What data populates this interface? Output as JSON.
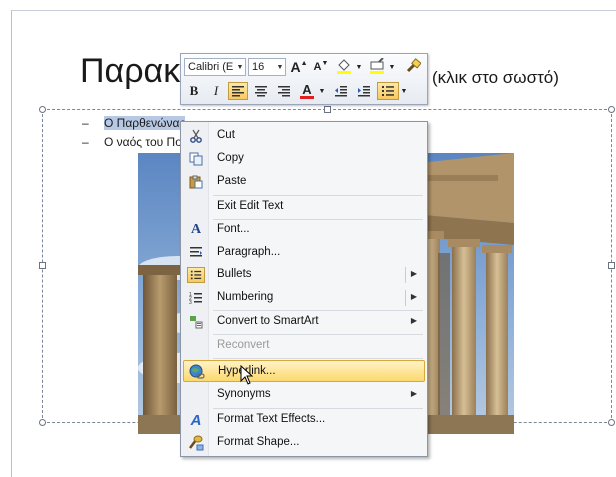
{
  "slide": {
    "title_left": "Παρακ",
    "title_right": "(κλικ στο σωστό)",
    "bullets": [
      {
        "text": "Ο Παρθενώνας",
        "selected": true
      },
      {
        "text": "Ο ναός του Πο",
        "selected": false
      }
    ]
  },
  "mini_toolbar": {
    "font_name": "Calibri (E",
    "font_size": "16",
    "bold_label": "B",
    "italic_label": "I",
    "grow_font_label": "A",
    "shrink_font_label": "A",
    "font_color_label": "A"
  },
  "context_menu": {
    "items": [
      {
        "label": "Cut",
        "icon": "scissors-icon"
      },
      {
        "label": "Copy",
        "icon": "copy-icon"
      },
      {
        "label": "Paste",
        "icon": "paste-icon"
      },
      {
        "label": "Exit Edit Text",
        "icon": ""
      },
      {
        "label": "Font...",
        "icon": "font-icon"
      },
      {
        "label": "Paragraph...",
        "icon": "paragraph-icon"
      },
      {
        "label": "Bullets",
        "icon": "bullets-icon",
        "submenu": true
      },
      {
        "label": "Numbering",
        "icon": "numbering-icon",
        "submenu": true
      },
      {
        "label": "Convert to SmartArt",
        "icon": "smartart-icon",
        "submenu": true
      },
      {
        "label": "Reconvert",
        "icon": "",
        "disabled": true
      },
      {
        "label": "Hyperlink...",
        "icon": "hyperlink-icon",
        "highlighted": true
      },
      {
        "label": "Synonyms",
        "icon": "",
        "submenu": true
      },
      {
        "label": "Format Text Effects...",
        "icon": "text-effects-icon"
      },
      {
        "label": "Format Shape...",
        "icon": "format-shape-icon"
      }
    ]
  },
  "colors": {
    "highlight": "#fcd96e",
    "selection": "#b6c8e4",
    "font_color_bar": "#e02020",
    "highlighter_bar": "#ffff00"
  }
}
